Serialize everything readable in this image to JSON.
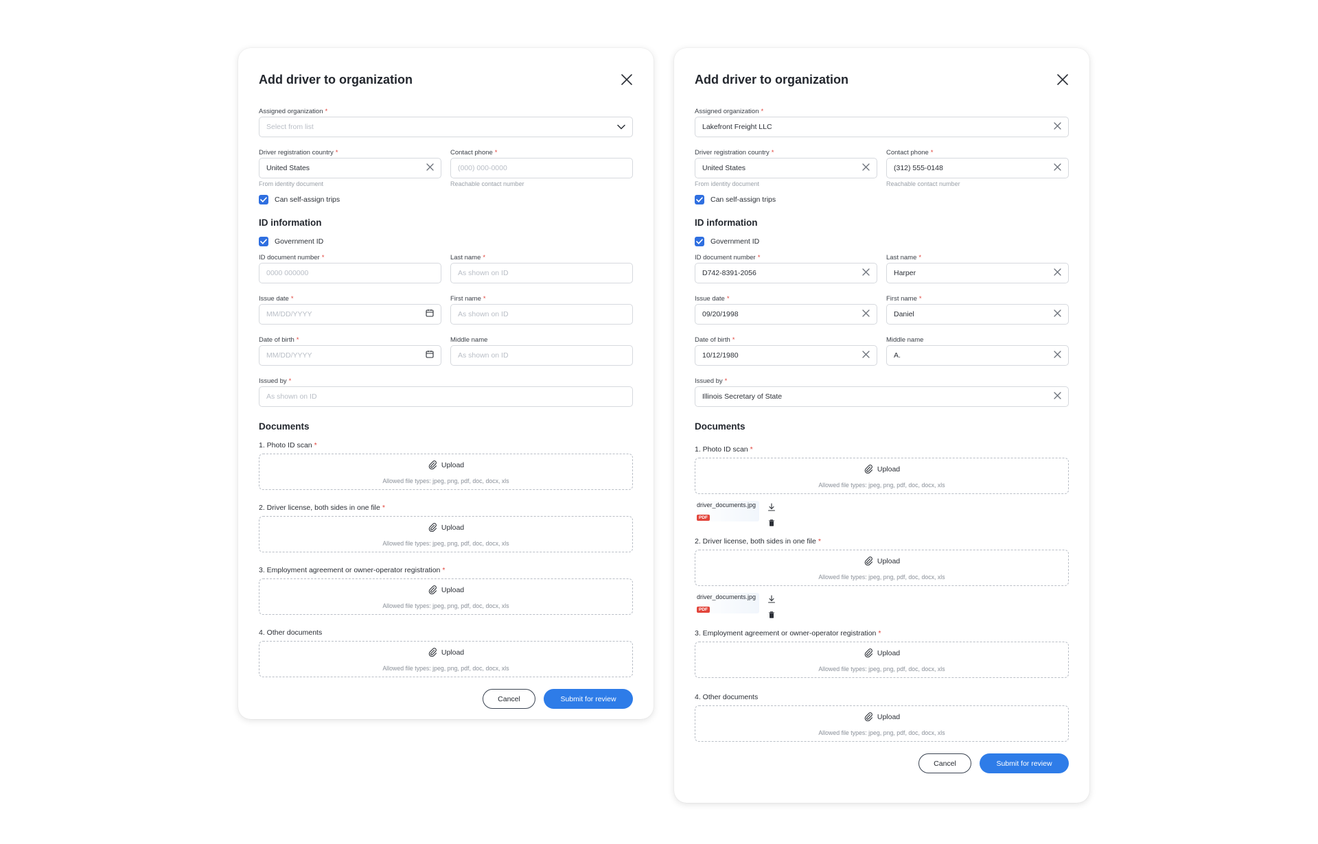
{
  "colors": {
    "accent": "#2e7ce8",
    "required": "#e1453d",
    "pdf_badge": "#e2453b"
  },
  "modals": [
    {
      "title": "Add driver to organization",
      "assigned_org": {
        "label": "Assigned organization",
        "value": "",
        "placeholder": "Select from list"
      },
      "country": {
        "label": "Driver registration country",
        "value": "United States",
        "hint": "From identity document"
      },
      "phone": {
        "label": "Contact phone",
        "value": "",
        "placeholder": "(000) 000-0000",
        "hint": "Reachable contact number"
      },
      "self_assign": {
        "label": "Can self-assign trips",
        "checked": true
      },
      "id_section": {
        "title": "ID information",
        "gov_id_label": "Government ID"
      },
      "id_number": {
        "label": "ID document number",
        "value": "",
        "placeholder": "0000 000000"
      },
      "last_name": {
        "label": "Last name",
        "value": "",
        "placeholder": "As shown on ID"
      },
      "issue_date": {
        "label": "Issue date",
        "value": "",
        "placeholder": "MM/DD/YYYY"
      },
      "first_name": {
        "label": "First name",
        "value": "",
        "placeholder": "As shown on ID"
      },
      "dob": {
        "label": "Date of birth",
        "value": "",
        "placeholder": "MM/DD/YYYY"
      },
      "middle_name": {
        "label": "Middle name",
        "value": "",
        "placeholder": "As shown on ID"
      },
      "issued_by": {
        "label": "Issued by",
        "value": "",
        "placeholder": "As shown on ID"
      },
      "documents": {
        "title": "Documents",
        "items": [
          {
            "label": "1. Photo ID scan",
            "required": true
          },
          {
            "label": "2. Driver license, both sides in one file",
            "required": true
          },
          {
            "label": "3. Employment agreement or owner-operator registration",
            "required": true
          },
          {
            "label": "4. Other documents",
            "required": false
          }
        ],
        "upload_label": "Upload",
        "allowed_text": "Allowed file types: jpeg, png, pdf, doc, docx, xls"
      },
      "cancel_label": "Cancel",
      "submit_label": "Submit for review"
    },
    {
      "title": "Add driver to organization",
      "assigned_org": {
        "label": "Assigned organization",
        "value": "Lakefront Freight LLC"
      },
      "country": {
        "label": "Driver registration country",
        "value": "United States",
        "hint": "From identity document"
      },
      "phone": {
        "label": "Contact phone",
        "value": "(312) 555-0148",
        "hint": "Reachable contact number"
      },
      "self_assign": {
        "label": "Can self-assign trips",
        "checked": true
      },
      "id_section": {
        "title": "ID information",
        "gov_id_label": "Government ID"
      },
      "id_number": {
        "label": "ID document number",
        "value": "D742-8391-2056"
      },
      "last_name": {
        "label": "Last name",
        "value": "Harper"
      },
      "issue_date": {
        "label": "Issue date",
        "value": "09/20/1998"
      },
      "first_name": {
        "label": "First name",
        "value": "Daniel"
      },
      "dob": {
        "label": "Date of birth",
        "value": "10/12/1980"
      },
      "middle_name": {
        "label": "Middle name",
        "value": "A."
      },
      "issued_by": {
        "label": "Issued by",
        "value": "Illinois Secretary of State"
      },
      "documents": {
        "title": "Documents",
        "items": [
          {
            "label": "1. Photo ID scan",
            "required": true,
            "file": {
              "name": "driver_documents.jpg",
              "badge": "PDF"
            }
          },
          {
            "label": "2. Driver license, both sides in one file",
            "required": true,
            "file": {
              "name": "driver_documents.jpg",
              "badge": "PDF"
            }
          },
          {
            "label": "3. Employment agreement or owner-operator registration",
            "required": true
          },
          {
            "label": "4. Other documents",
            "required": false
          }
        ],
        "upload_label": "Upload",
        "allowed_text": "Allowed file types: jpeg, png, pdf, doc, docx, xls"
      },
      "cancel_label": "Cancel",
      "submit_label": "Submit for review"
    }
  ]
}
